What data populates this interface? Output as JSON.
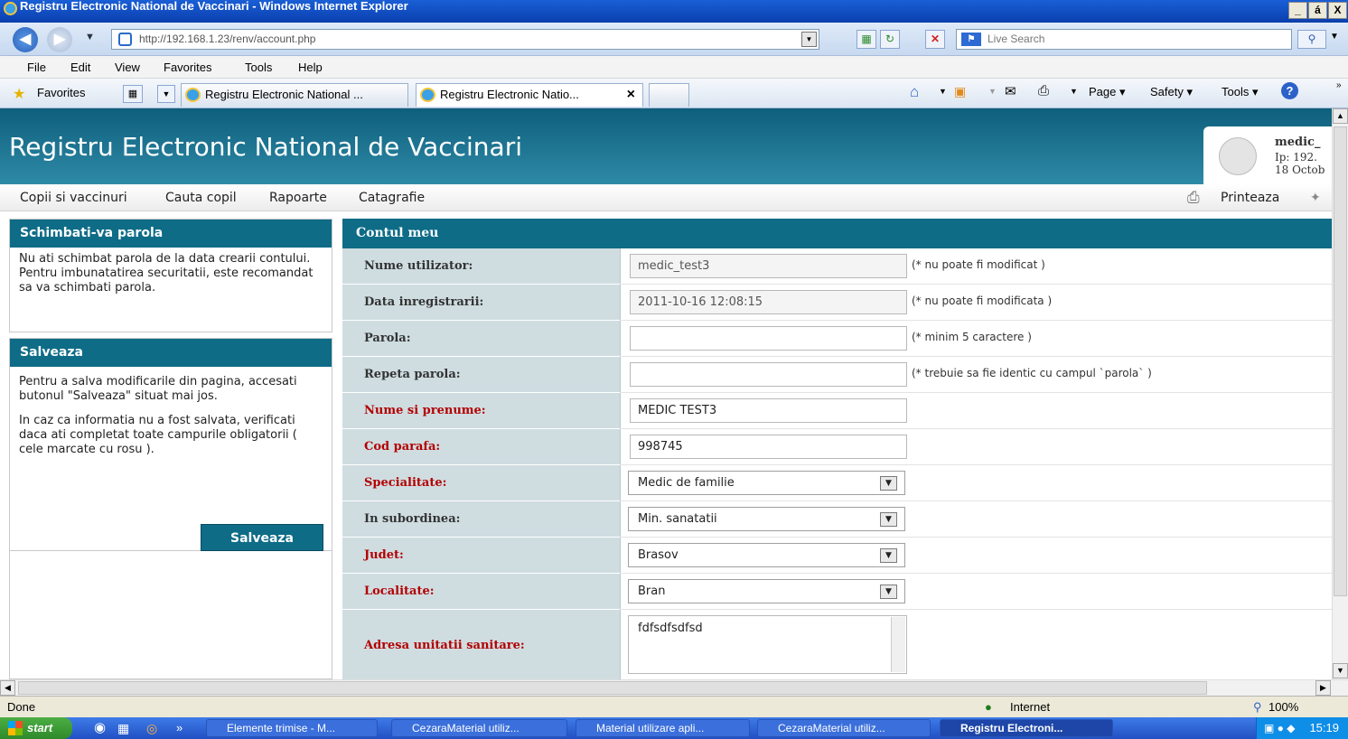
{
  "window": {
    "title": "Registru Electronic National de Vaccinari - Windows Internet Explorer",
    "min": "_",
    "max": "á",
    "close": "X"
  },
  "browser": {
    "url": "http://192.168.1.23/renv/account.php",
    "search_placeholder": "Live Search",
    "menu": [
      "File",
      "Edit",
      "View",
      "Favorites",
      "Tools",
      "Help"
    ],
    "favorites_label": "Favorites",
    "tabs": [
      {
        "label": "Registru Electronic National ..."
      },
      {
        "label": "Registru Electronic Natio...",
        "close": "×"
      }
    ],
    "commands": {
      "page": "Page ▾",
      "safety": "Safety ▾",
      "tools": "Tools ▾"
    }
  },
  "app": {
    "title": "Registru Electronic National de Vaccinari",
    "user": {
      "name": "medic_",
      "ip": "Ip: 192.",
      "date": "18 Octob"
    },
    "nav": [
      "Copii si vaccinuri",
      "Cauta copil",
      "Rapoarte",
      "Catagrafie"
    ],
    "print_label": "Printeaza",
    "left": {
      "password_title": "Schimbati-va parola",
      "password_text": "Nu ati schimbat parola de la data crearii contului.\nPentru imbunatatirea securitatii, este recomandat sa va schimbati parola.",
      "save_title": "Salveaza",
      "save_text": "Pentru a salva modificarile din pagina, accesati butonul \"Salveaza\" situat mai jos.",
      "save_text2": "In caz ca informatia nu a fost salvata, verificati daca ati completat toate campurile obligatorii ( cele marcate cu rosu ).",
      "save_button": "Salveaza"
    },
    "form": {
      "title": "Contul meu",
      "username_label": "Nume utilizator:",
      "username_value": "medic_test3",
      "username_note": "(* nu poate fi modificat )",
      "regdate_label": "Data inregistrarii:",
      "regdate_value": "2011-10-16 12:08:15",
      "regdate_note": "(* nu poate fi modificata )",
      "password_label": "Parola:",
      "password_note": "(* minim 5 caractere )",
      "password2_label": "Repeta parola:",
      "password2_note": "(* trebuie sa fie identic cu campul `parola` )",
      "fullname_label": "Nume si prenume:",
      "fullname_value": "MEDIC TEST3",
      "code_label": "Cod parafa:",
      "code_value": "998745",
      "specialty_label": "Specialitate:",
      "specialty_value": "Medic de familie",
      "subordination_label": "In subordinea:",
      "subordination_value": "Min. sanatatii",
      "county_label": "Judet:",
      "county_value": "Brasov",
      "locality_label": "Localitate:",
      "locality_value": "Bran",
      "address_label": "Adresa unitatii sanitare:",
      "address_value": "fdfsdfsdfsd"
    }
  },
  "status": {
    "text": "Done",
    "zone": "Internet",
    "zoom": "100%"
  },
  "taskbar": {
    "start": "start",
    "items": [
      "Elemente trimise - M...",
      "CezaraMaterial utiliz...",
      "Material utilizare apli...",
      "CezaraMaterial utiliz...",
      "Registru Electroni..."
    ],
    "clock": "15:19"
  }
}
